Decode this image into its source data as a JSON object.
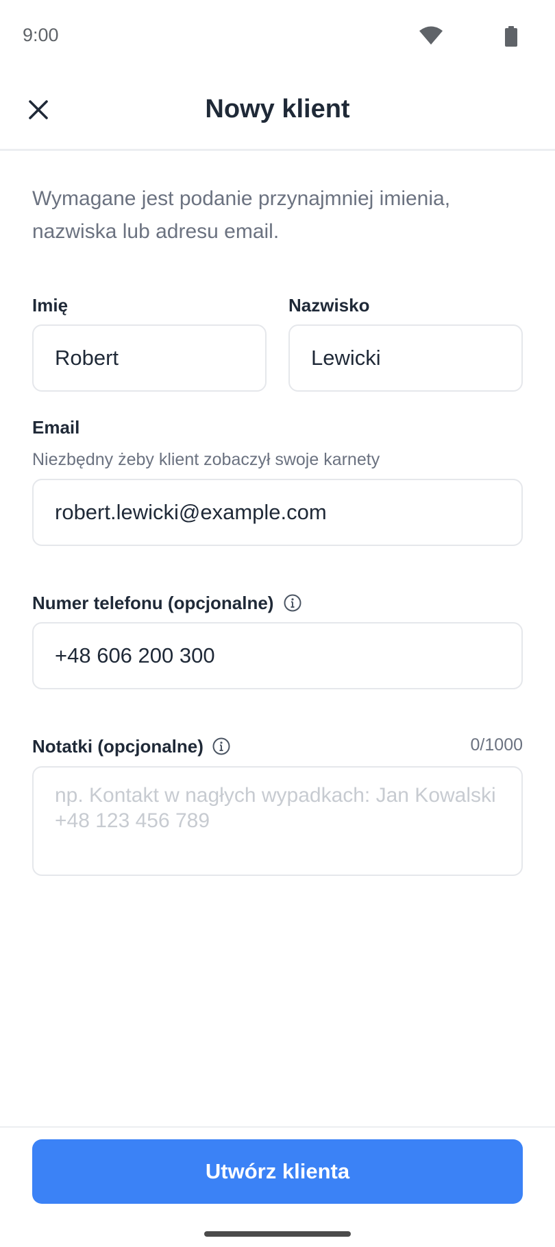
{
  "status_bar": {
    "time": "9:00"
  },
  "header": {
    "title": "Nowy klient"
  },
  "intro_text": "Wymagane jest podanie przynajmniej imienia, nazwiska lub adresu email.",
  "fields": {
    "first_name": {
      "label": "Imię",
      "value": "Robert"
    },
    "last_name": {
      "label": "Nazwisko",
      "value": "Lewicki"
    },
    "email": {
      "label": "Email",
      "help": "Niezbędny żeby klient zobaczył swoje karnety",
      "value": "robert.lewicki@example.com"
    },
    "phone": {
      "label": "Numer telefonu (opcjonalne)",
      "value": "+48 606 200 300"
    },
    "notes": {
      "label": "Notatki (opcjonalne)",
      "counter": "0/1000",
      "placeholder": "np. Kontakt w nagłych wypadkach: Jan Kowalski +48 123 456 789",
      "value": ""
    }
  },
  "footer": {
    "submit_label": "Utwórz klienta"
  },
  "icons": {
    "close": "close-icon",
    "info": "info-icon",
    "wifi": "wifi-icon",
    "battery": "battery-icon"
  },
  "colors": {
    "accent": "#3b82f6",
    "text_primary": "#1f2937",
    "text_secondary": "#6b7280",
    "border": "#e5e7eb"
  }
}
